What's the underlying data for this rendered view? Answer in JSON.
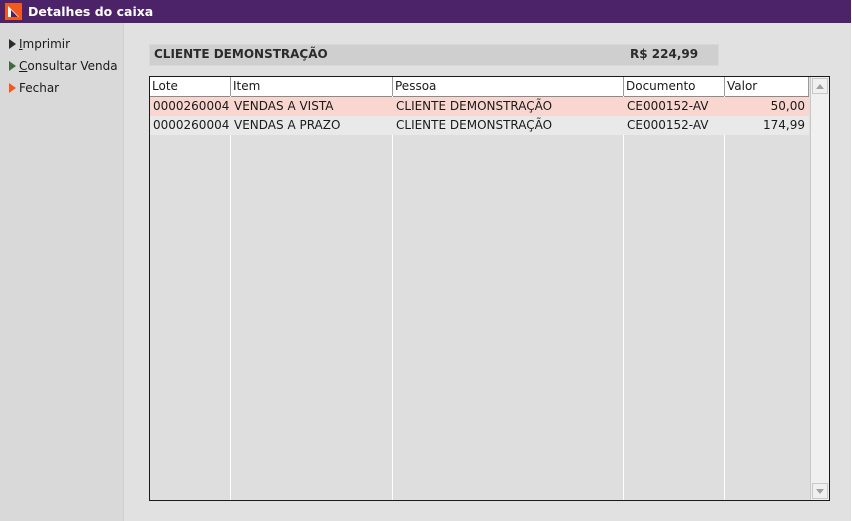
{
  "window": {
    "title": "Detalhes do caixa"
  },
  "sidebar": {
    "items": [
      {
        "label": "Imprimir",
        "icon": "play-arrow-dark-icon"
      },
      {
        "label": "Consultar Venda",
        "icon": "play-arrow-green-icon"
      },
      {
        "label": "Fechar",
        "icon": "play-arrow-orange-icon"
      }
    ]
  },
  "summary": {
    "client_name": "CLIENTE DEMONSTRAÇÃO",
    "total": "R$ 224,99"
  },
  "table": {
    "headers": [
      "Lote",
      "Item",
      "Pessoa",
      "Documento",
      "Valor"
    ],
    "rows": [
      {
        "lote": "0000260004",
        "item": "VENDAS A VISTA",
        "pessoa": "CLIENTE DEMONSTRAÇÃO",
        "documento": "CE000152-AV",
        "valor": "50,00",
        "selected": true
      },
      {
        "lote": "0000260004",
        "item": "VENDAS A PRAZO",
        "pessoa": "CLIENTE DEMONSTRAÇÃO",
        "documento": "CE000152-AV",
        "valor": "174,99",
        "selected": false
      }
    ]
  },
  "colors": {
    "titlebar": "#4c2268",
    "selected_row": "#f9d6cf",
    "normal_row": "#e9e9e9",
    "accent_orange": "#f05a1e"
  }
}
